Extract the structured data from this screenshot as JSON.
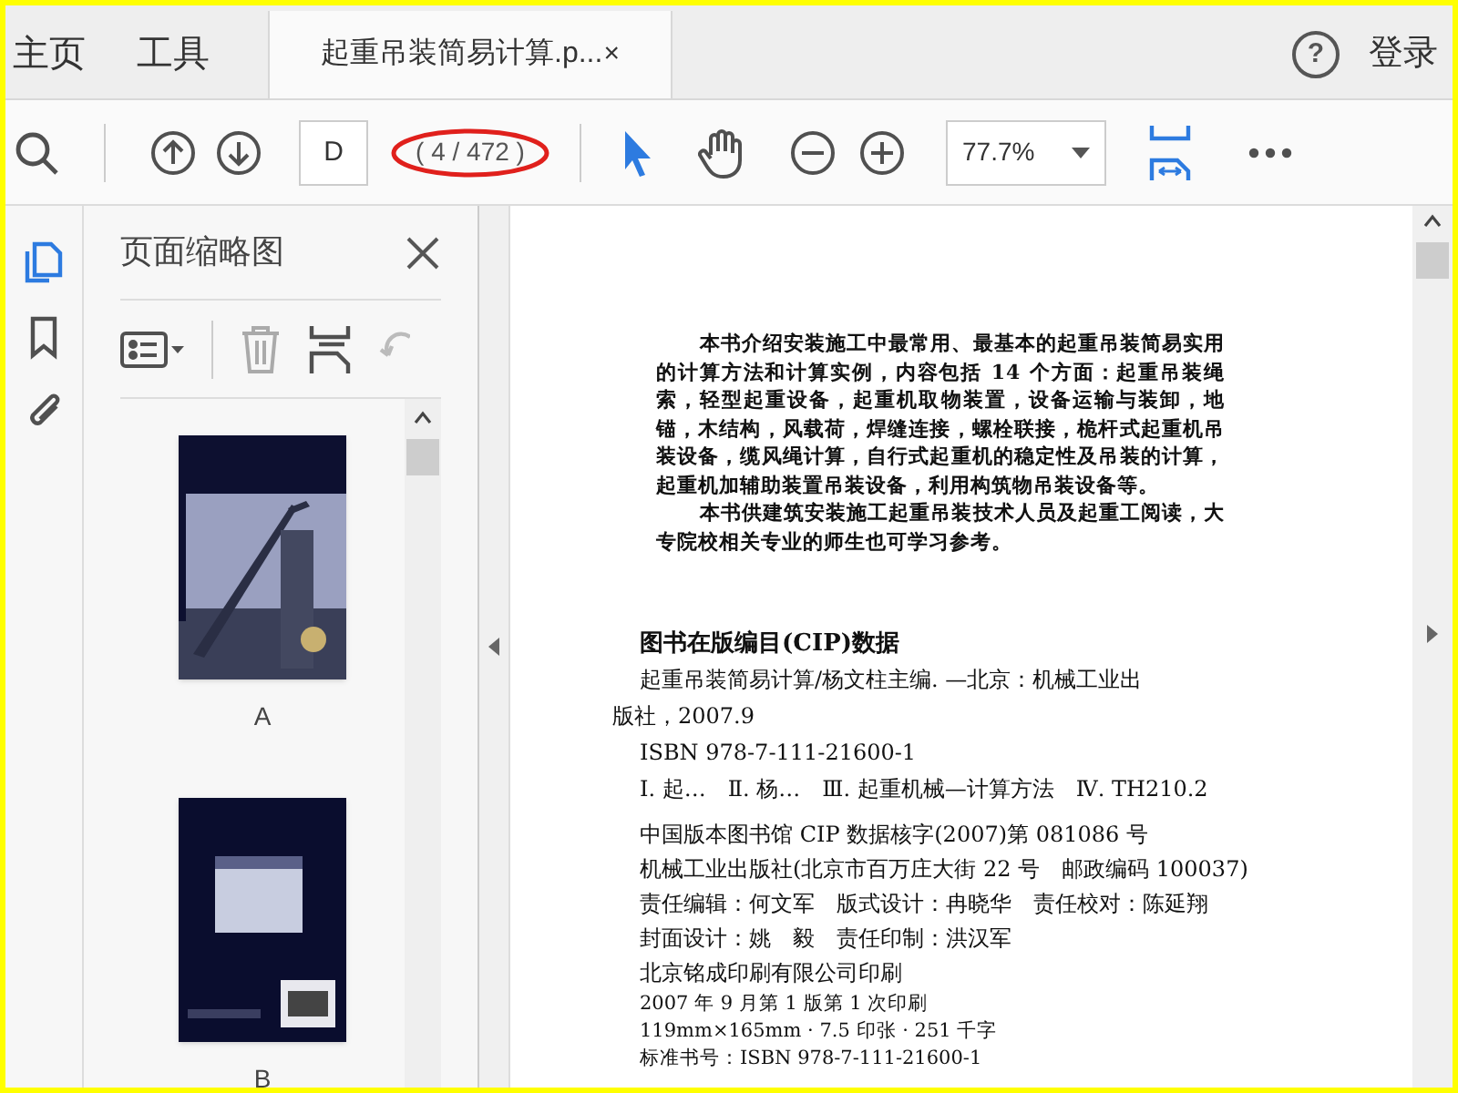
{
  "nav_tabs": [
    {
      "label": "主页",
      "selected": false
    },
    {
      "label": "工具",
      "selected": false
    }
  ],
  "document_tab": {
    "title": "起重吊装简易计算.p...",
    "close": "×",
    "selected": true
  },
  "account": {
    "help": "?",
    "login": "登录"
  },
  "toolbar": {
    "page_field": "D",
    "page_count": "( 4 / 472 )",
    "page_count_circled": true,
    "zoom": "77.7%"
  },
  "sidebar": {
    "rail": [
      {
        "kind": "pages",
        "selected": true
      },
      {
        "kind": "bookmarks",
        "selected": false
      },
      {
        "kind": "attachments",
        "selected": false
      }
    ],
    "title": "页面缩略图",
    "thumbnails": [
      {
        "kind": "front",
        "label": "A"
      },
      {
        "kind": "back",
        "label": "B"
      }
    ]
  },
  "page": {
    "blurb": [
      "本书介绍安装施工中最常用、最基本的起重吊装简易实用的计算方法和计算实例，内容包括 14 个方面：起重吊装绳索，轻型起重设备，起重机取物装置，设备运输与装卸，地锚，木结构，风载荷，焊缝连接，螺栓联接，桅杆式起重机吊装设备，缆风绳计算，自行式起重机的稳定性及吊装的计算，起重机加辅助装置吊装设备，利用构筑物吊装设备等。",
      "本书供建筑安装施工起重吊装技术人员及起重工阅读，大专院校相关专业的师生也可学习参考。"
    ],
    "cip_title": "图书在版编目(CIP)数据",
    "cip_lines": [
      {
        "text": "起重吊装简易计算/杨文柱主编. —北京：机械工业出",
        "indent": true
      },
      {
        "text": "版社，2007.9",
        "indent": false
      },
      {
        "text": "ISBN 978-7-111-21600-1",
        "indent": true
      },
      {
        "text": "Ⅰ. 起…　Ⅱ. 杨…　Ⅲ. 起重机械—计算方法　Ⅳ. TH210.2",
        "indent": true
      }
    ],
    "imprint_lines": [
      "中国版本图书馆 CIP 数据核字(2007)第 081086 号",
      "机械工业出版社(北京市百万庄大街 22 号　邮政编码 100037)",
      "责任编辑：何文军　版式设计：冉晓华　责任校对：陈延翔",
      "封面设计：姚　毅　责任印制：洪汉军",
      "北京铭成印刷有限公司印刷",
      "2007 年 9 月第 1 版第 1 次印刷",
      "119mm×165mm · 7.5 印张 · 251 千字",
      "标准书号：ISBN 978-7-111-21600-1"
    ]
  }
}
